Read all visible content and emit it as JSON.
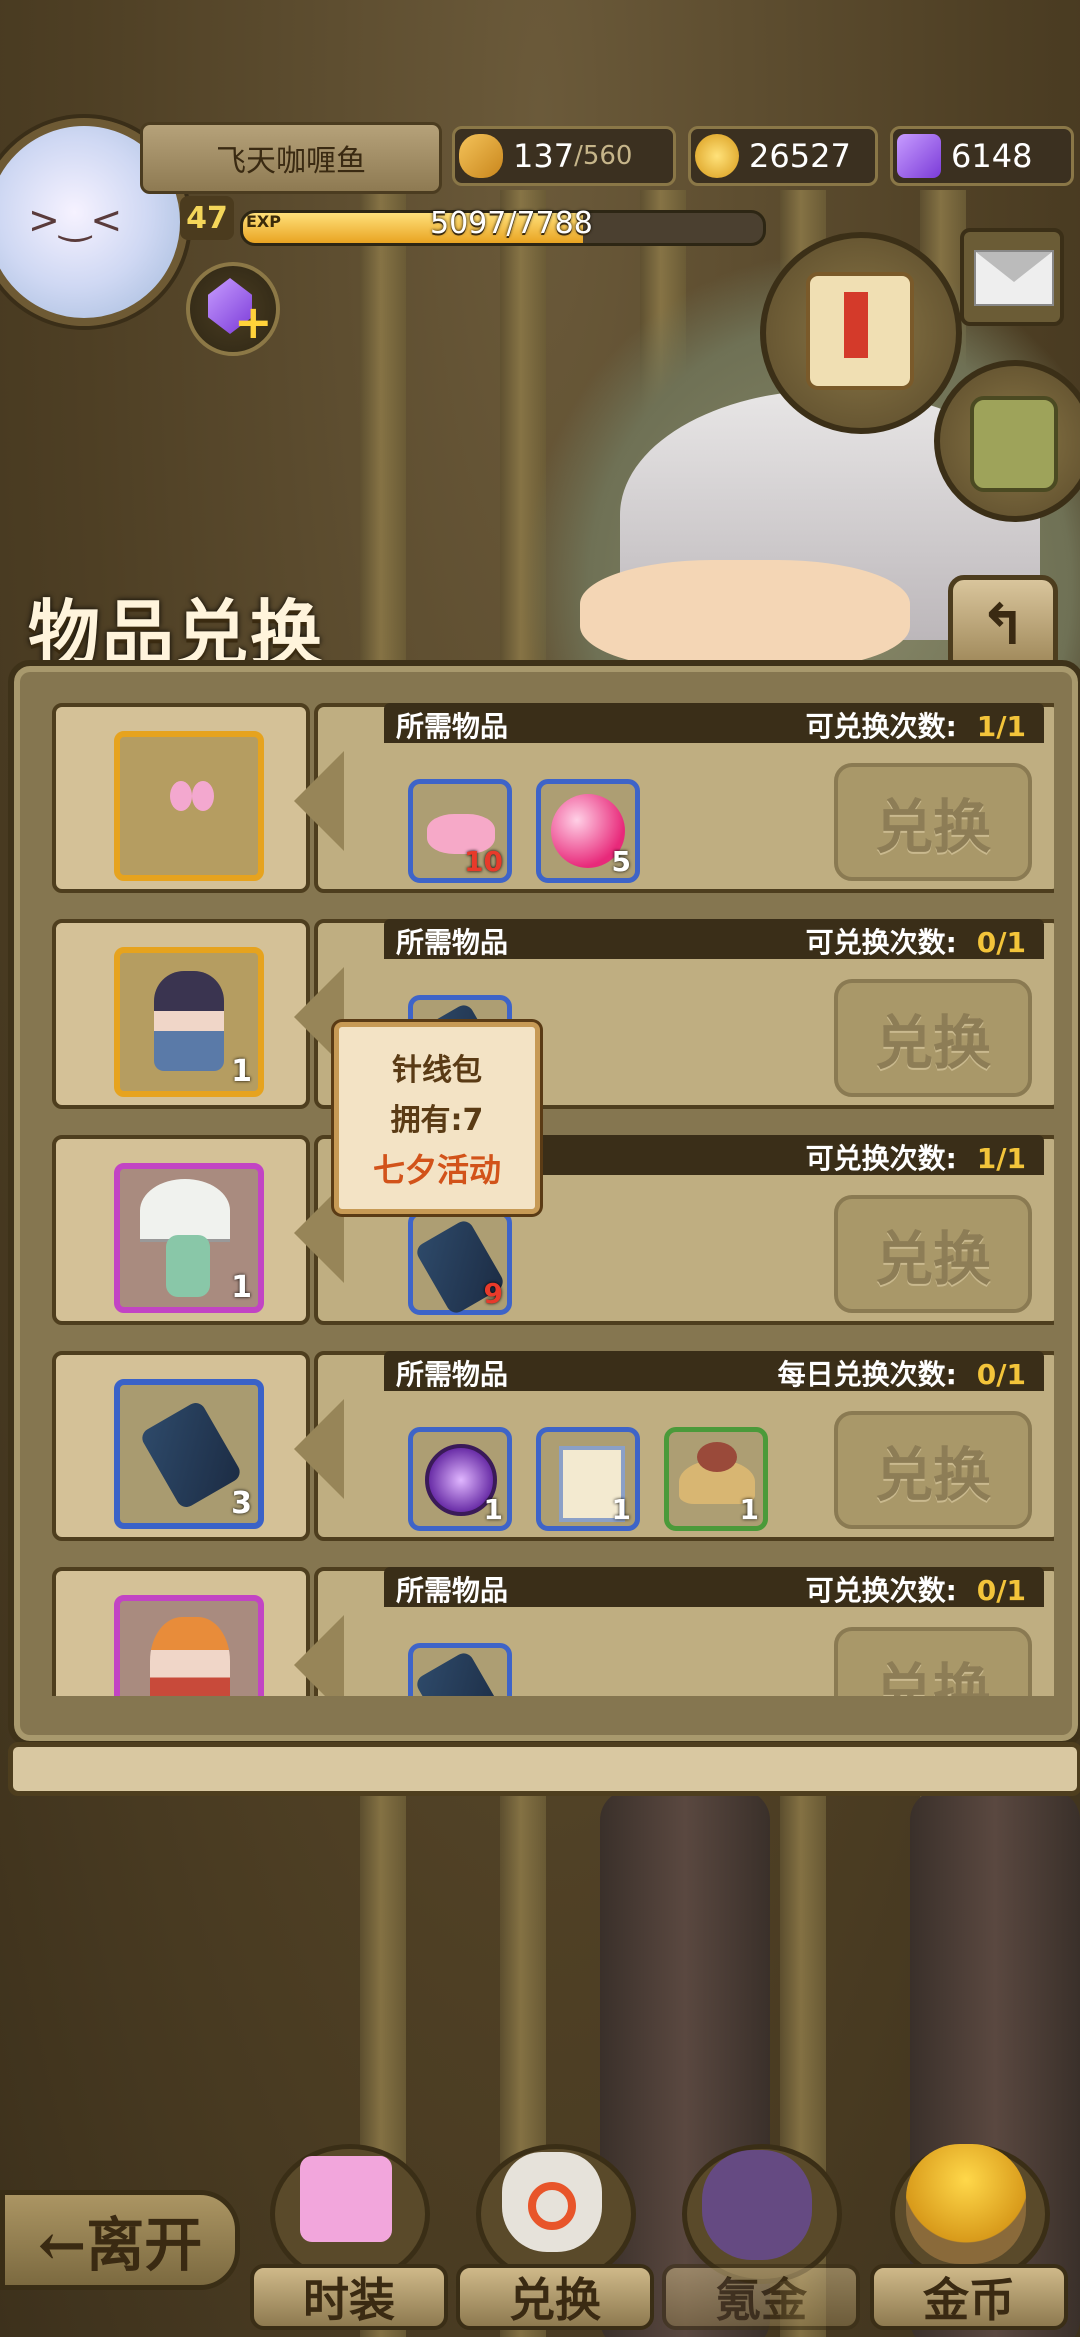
{
  "player": {
    "name": "飞天咖喱鱼",
    "level": "47",
    "exp_label": "EXP",
    "exp_text": "5097/7788",
    "exp_fraction": 0.6545
  },
  "resources": {
    "stamina": "137",
    "stamina_max": "/560",
    "gold": "26527",
    "gems": "6148"
  },
  "panel": {
    "title": "物品兑换",
    "rows": [
      {
        "req_label": "所需物品",
        "count_label": "可兑换次数:",
        "count": "1/1",
        "target_count": "",
        "materials": [
          "10",
          "5"
        ],
        "button": "兑换"
      },
      {
        "req_label": "所需物品",
        "count_label": "可兑换次数:",
        "count": "0/1",
        "target_count": "1",
        "materials": [],
        "button": "兑换"
      },
      {
        "req_label": "",
        "count_label": "可兑换次数:",
        "count": "1/1",
        "target_count": "1",
        "materials": [
          "9"
        ],
        "button": "兑换"
      },
      {
        "req_label": "所需物品",
        "count_label": "每日兑换次数:",
        "count": "0/1",
        "target_count": "3",
        "materials": [
          "1",
          "1",
          "1"
        ],
        "button": "兑换"
      },
      {
        "req_label": "所需物品",
        "count_label": "可兑换次数:",
        "count": "0/1",
        "target_count": "",
        "materials": [],
        "button": "兑换"
      }
    ]
  },
  "tooltip": {
    "name": "针线包",
    "owned": "拥有:7",
    "source": "七夕活动"
  },
  "nav": {
    "leave": "←离开",
    "fashion": "时装",
    "exchange": "兑换",
    "krypton": "氪金",
    "gold": "金币"
  },
  "colors": {
    "accent_gold": "#f3c43a",
    "tooltip_source": "#d2531a"
  }
}
